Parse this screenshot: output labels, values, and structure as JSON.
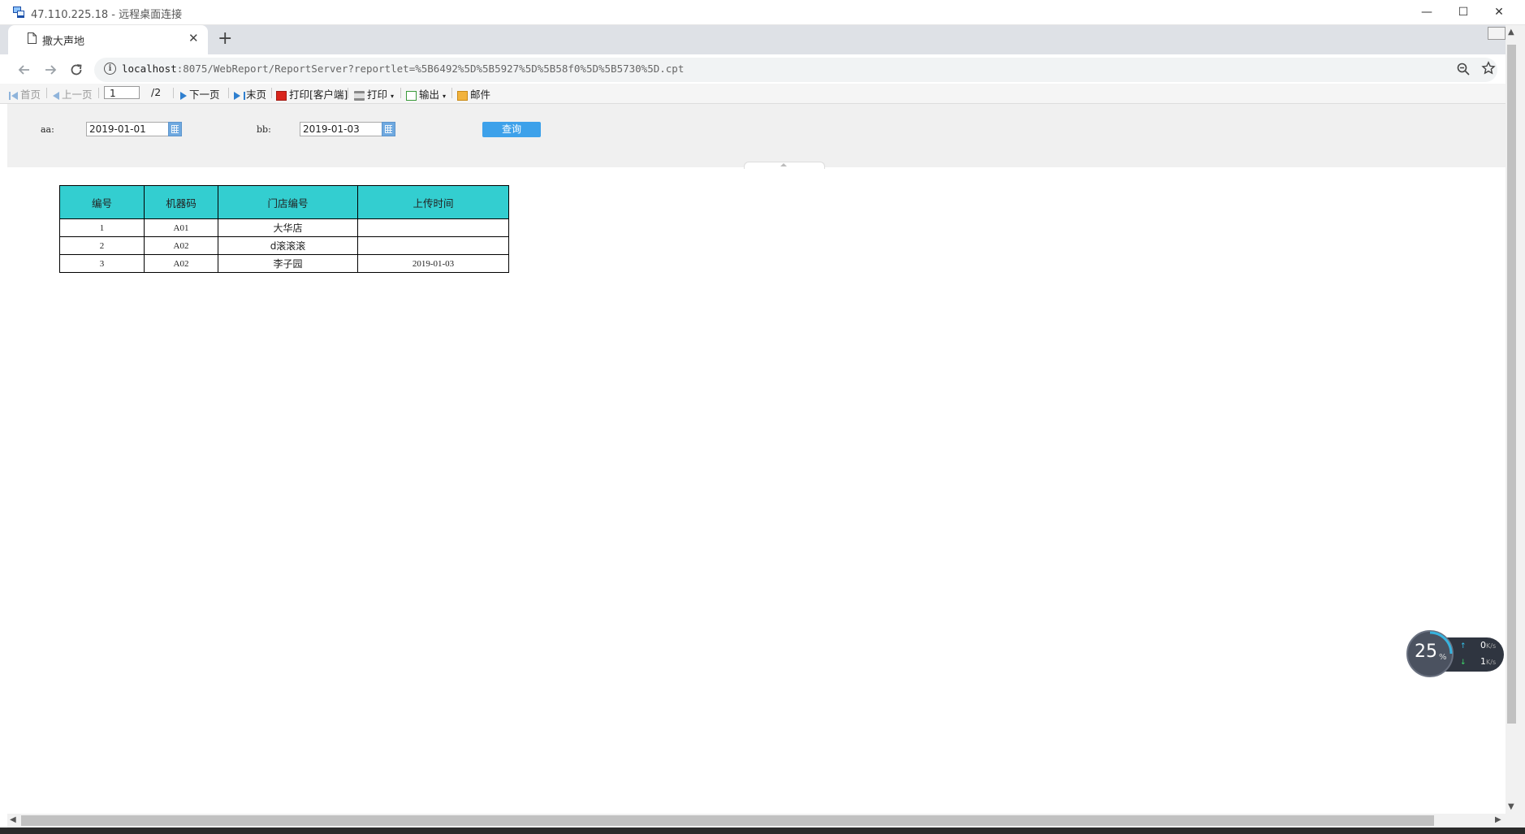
{
  "rdp": {
    "title": "47.110.225.18 - 远程桌面连接",
    "minimize": "—",
    "maximize": "☐",
    "close": "✕"
  },
  "browser": {
    "tab_title": "撒大声地",
    "tab_close": "✕",
    "new_tab": "+",
    "url_host": "localhost",
    "url_rest": ":8075/WebReport/ReportServer?reportlet=%5B6492%5D%5B5927%5D%5B58f0%5D%5B5730%5D.cpt",
    "info": "i"
  },
  "report_toolbar": {
    "first": "首页",
    "prev": "上一页",
    "page_current": "1",
    "page_total": "/2",
    "next": "下一页",
    "last": "末页",
    "print_client": "打印[客户端]",
    "print": "打印",
    "export": "输出",
    "mail": "邮件"
  },
  "params": {
    "aa_label": "aa:",
    "aa_value": "2019-01-01",
    "bb_label": "bb:",
    "bb_value": "2019-01-03",
    "query": "查询"
  },
  "table": {
    "headers": [
      "编号",
      "机器码",
      "门店编号",
      "上传时间"
    ],
    "rows": [
      [
        "1",
        "A01",
        "大华店",
        ""
      ],
      [
        "2",
        "A02",
        "d滚滚滚",
        ""
      ],
      [
        "3",
        "A02",
        "李子园",
        "2019-01-03"
      ]
    ]
  },
  "net_monitor": {
    "cpu": "25",
    "cpu_unit": "%",
    "up_value": "0",
    "down_value": "1",
    "unit": "K/s"
  }
}
